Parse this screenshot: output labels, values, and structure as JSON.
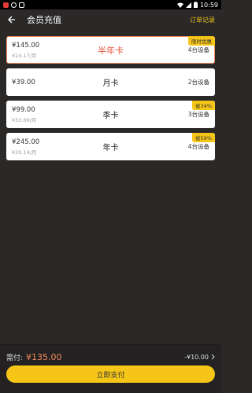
{
  "status_bar": {
    "time": "10:59"
  },
  "header": {
    "title": "会员充值",
    "order_link": "订单记录"
  },
  "plans": [
    {
      "price": "¥145.00",
      "per_month": "¥24.17/月",
      "name": "半年卡",
      "devices": "4台设备",
      "badge": "限时优惠",
      "selected": true
    },
    {
      "price": "¥39.00",
      "per_month": "",
      "name": "月卡",
      "devices": "2台设备",
      "badge": "",
      "selected": false
    },
    {
      "price": "¥99.00",
      "per_month": "¥33.00/月",
      "name": "季卡",
      "devices": "3台设备",
      "badge": "省34%",
      "selected": false
    },
    {
      "price": "¥245.00",
      "per_month": "¥20.14/月",
      "name": "年卡",
      "devices": "4台设备",
      "badge": "省59%",
      "selected": false
    }
  ],
  "payment": {
    "label": "需付:",
    "amount": "¥135.00",
    "discount": "-¥10.00",
    "button_label": "立即支付"
  },
  "colors": {
    "background": "#2b2828",
    "accent_yellow": "#f5c518",
    "highlight_orange": "#e5553b"
  }
}
